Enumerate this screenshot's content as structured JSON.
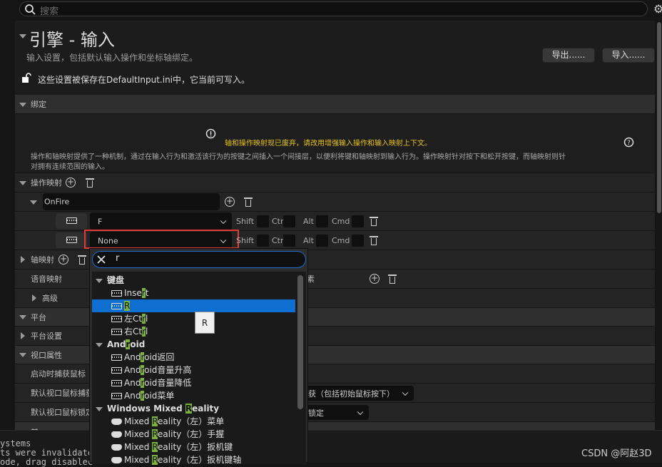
{
  "search": {
    "placeholder": "搜索"
  },
  "header": {
    "title": "引擎 - 输入",
    "subtitle": "输入设置，包括默认输入操作和坐标轴绑定。",
    "save_note": "这些设置被保存在DefaultInput.ini中，它当前可写入。",
    "export_label": "导出......",
    "import_label": "导入......"
  },
  "bindings": {
    "section": "绑定",
    "warning": "轴和操作映射现已废弃，请改用增强输入操作和输入映射上下文。",
    "description_1": "操作和轴映射提供了一种机制，通过在输入行为和激活该行为的按键之间插入一个间接层，以便利将键和轴映射到输入行为。操作映射针对按下和松开按键，而轴映射则针",
    "description_2": "对拥有连续范围的输入。",
    "action_mappings": "操作映射",
    "action_name": "OnFire",
    "keys": [
      {
        "value": "F"
      },
      {
        "value": "None"
      }
    ],
    "modifiers": {
      "shift": "Shift",
      "ctrl": "Ctrl",
      "alt": "Alt",
      "cmd": "Cmd"
    },
    "axis_mappings": "轴映射",
    "speech_mappings": "语音映射",
    "speech_partial": "素",
    "advanced": "高级"
  },
  "platform": {
    "section": "平台",
    "settings": "平台设置"
  },
  "viewport": {
    "section": "视口属性",
    "capture_on_start": "启动时捕获鼠标",
    "default_capture": "默认视口鼠标捕获",
    "default_capture_value": "获（包括初始鼠标按下）",
    "default_lock": "默认视口鼠标锁定",
    "default_lock_value": "锁定",
    "next_section": "其"
  },
  "dropdown": {
    "search_value": "r",
    "tooltip": "R",
    "items": [
      {
        "type": "cat",
        "pre": "键盘",
        "m": "",
        "post": ""
      },
      {
        "type": "kb",
        "pre": "Inse",
        "m": "r",
        "post": "t"
      },
      {
        "type": "kb",
        "pre": "",
        "m": "R",
        "post": "",
        "selected": true
      },
      {
        "type": "kb",
        "pre": "左Ct",
        "m": "r",
        "post": "l"
      },
      {
        "type": "kb",
        "pre": "右Ct",
        "m": "r",
        "post": "l"
      },
      {
        "type": "cat",
        "pre": "And",
        "m": "r",
        "post": "oid"
      },
      {
        "type": "kb",
        "pre": "And",
        "m": "r",
        "post": "oid返回"
      },
      {
        "type": "kb",
        "pre": "And",
        "m": "r",
        "post": "oid音量升高"
      },
      {
        "type": "kb",
        "pre": "And",
        "m": "r",
        "post": "oid音量降低"
      },
      {
        "type": "kb",
        "pre": "And",
        "m": "r",
        "post": "oid菜单"
      },
      {
        "type": "cat",
        "pre": "Windows Mixed ",
        "m": "R",
        "post": "eality"
      },
      {
        "type": "pad",
        "pre": "Mixed ",
        "m": "R",
        "post": "eality（左）菜单"
      },
      {
        "type": "pad",
        "pre": "Mixed ",
        "m": "R",
        "post": "eality（左）手握"
      },
      {
        "type": "pad",
        "pre": "Mixed ",
        "m": "R",
        "post": "eality（左）扳机键"
      },
      {
        "type": "pad",
        "pre": "Mixed ",
        "m": "R",
        "post": "eality（左）扳机键轴"
      }
    ]
  },
  "log": {
    "lines": [
      "ystems",
      "ts were invalidate",
      "ode, drag disablec"
    ]
  },
  "watermark": "CSDN @阿赵3D",
  "colors": {
    "accent": "#0f6fd0",
    "highlight": "#7db33a",
    "warning": "#e8c31a",
    "focus_outline": "#e53935"
  }
}
